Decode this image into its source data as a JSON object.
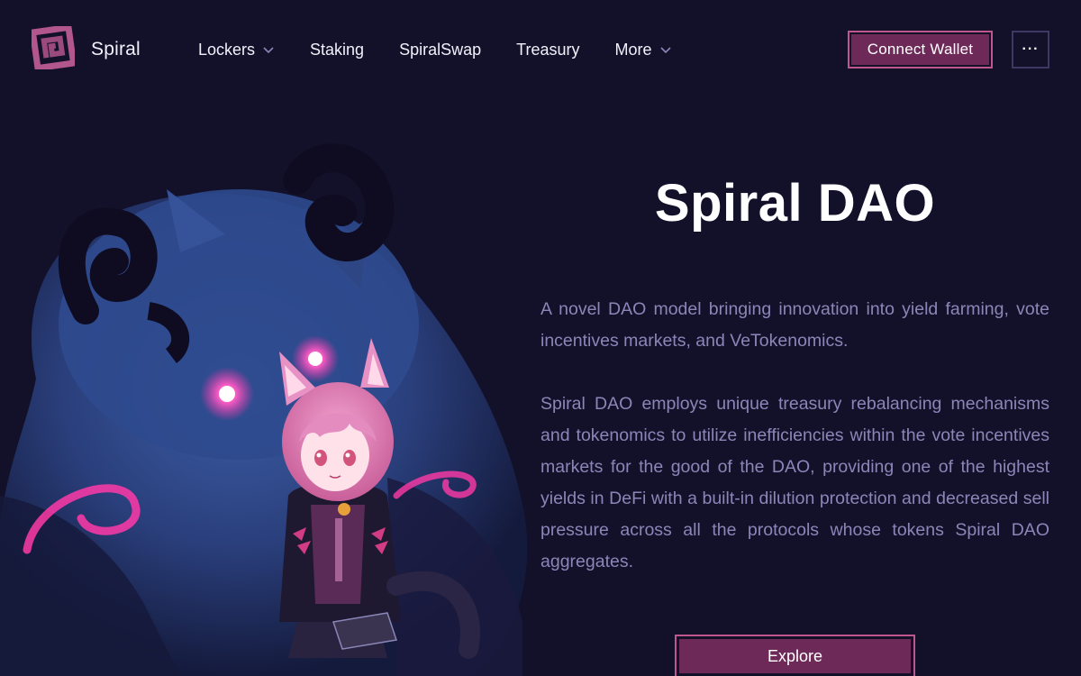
{
  "nav": {
    "brand_name": "Spiral",
    "logo_icon": "spiral-logo-icon",
    "items": [
      {
        "label": "Lockers",
        "has_dropdown": true
      },
      {
        "label": "Staking",
        "has_dropdown": false
      },
      {
        "label": "SpiralSwap",
        "has_dropdown": false
      },
      {
        "label": "Treasury",
        "has_dropdown": false
      },
      {
        "label": "More",
        "has_dropdown": true
      }
    ],
    "connect_wallet_label": "Connect Wallet",
    "more_options_label": "···"
  },
  "hero": {
    "title": "Spiral DAO",
    "paragraph_1": "A novel DAO model bringing innovation into yield farming, vote incentives markets, and VeTokenomics.",
    "paragraph_2": "Spiral DAO employs unique treasury rebalancing mechanisms and tokenomics to utilize inefficiencies within the vote incentives markets for the good of the DAO, providing one of the highest yields in DeFi with a built-in dilution protection and decreased sell pressure across all the protocols whose tokens Spiral DAO aggregates.",
    "explore_label": "Explore",
    "illustration": "hero-illustration"
  },
  "colors": {
    "background": "#13112a",
    "accent": "#c0568e",
    "button_fill": "#6d2a58",
    "body_text": "#8a86b8"
  }
}
